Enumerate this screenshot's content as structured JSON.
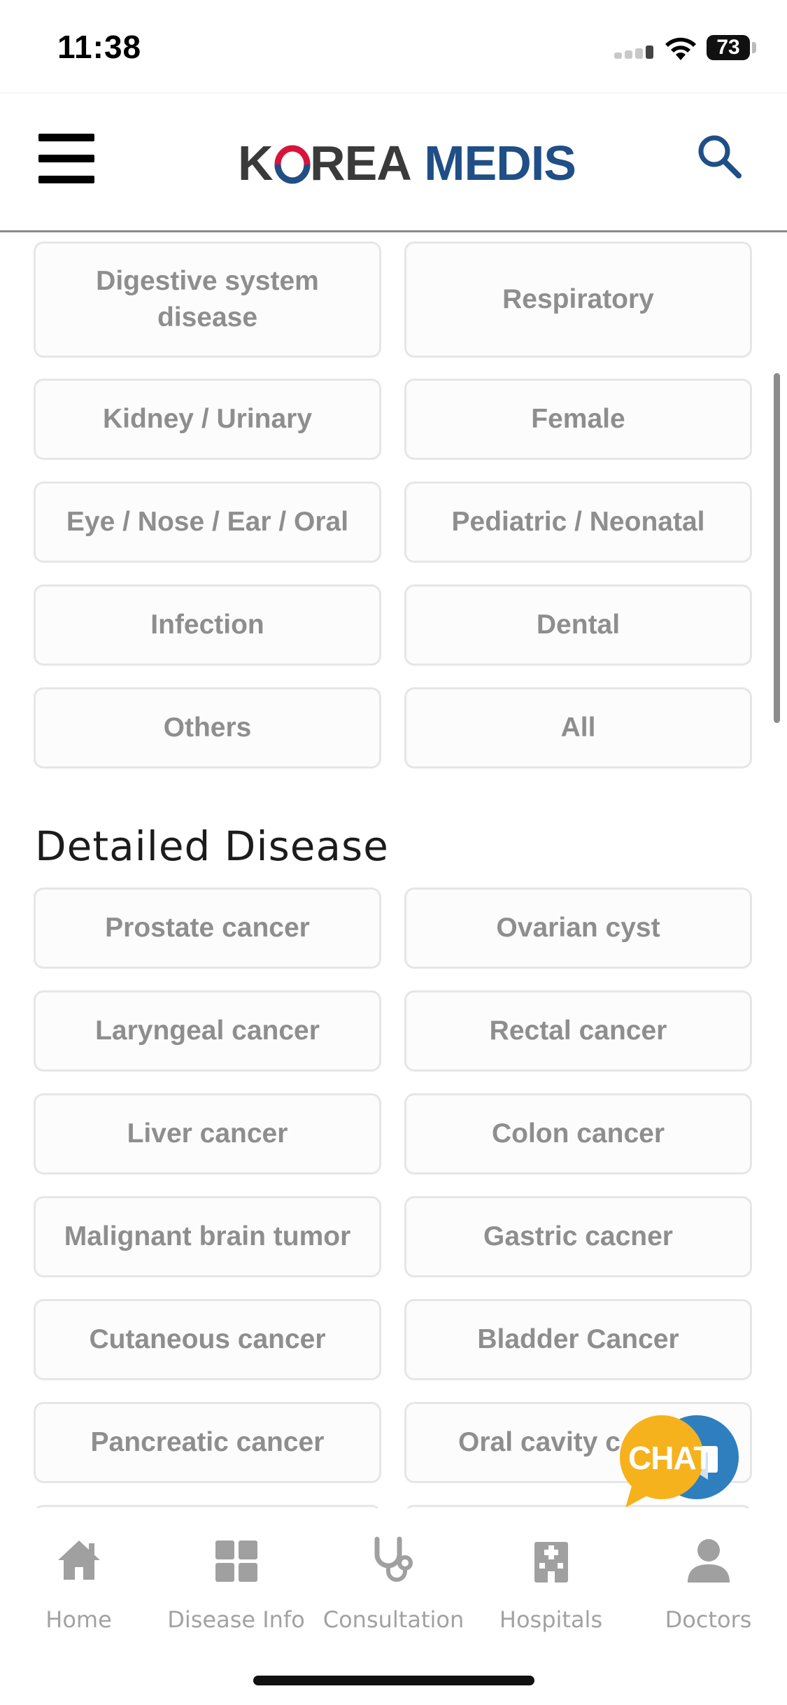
{
  "status_bar": {
    "time": "11:38",
    "battery": "73"
  },
  "header": {
    "logo_part1": "K",
    "logo_part2": "O",
    "logo_part3": "REA",
    "logo_part4": "MEDIS"
  },
  "categories": [
    "Digestive system disease",
    "Respiratory",
    "Kidney / Urinary",
    "Female",
    "Eye / Nose / Ear / Oral",
    "Pediatric / Neonatal",
    "Infection",
    "Dental",
    "Others",
    "All"
  ],
  "detailed_section_title": "Detailed Disease",
  "detailed": [
    "Prostate cancer",
    "Ovarian cyst",
    "Laryngeal cancer",
    "Rectal cancer",
    "Liver cancer",
    "Colon cancer",
    "Malignant brain tumor",
    "Gastric cacner",
    "Cutaneous cancer",
    "Bladder Cancer",
    "Pancreatic cancer",
    "Oral cavity c"
  ],
  "chat_label": "CHAT",
  "tabs": [
    {
      "label": "Home",
      "icon": "home-icon"
    },
    {
      "label": "Disease Info",
      "icon": "grid-icon"
    },
    {
      "label": "Consultation",
      "icon": "stethoscope-icon"
    },
    {
      "label": "Hospitals",
      "icon": "hospital-icon"
    },
    {
      "label": "Doctors",
      "icon": "person-icon"
    }
  ]
}
